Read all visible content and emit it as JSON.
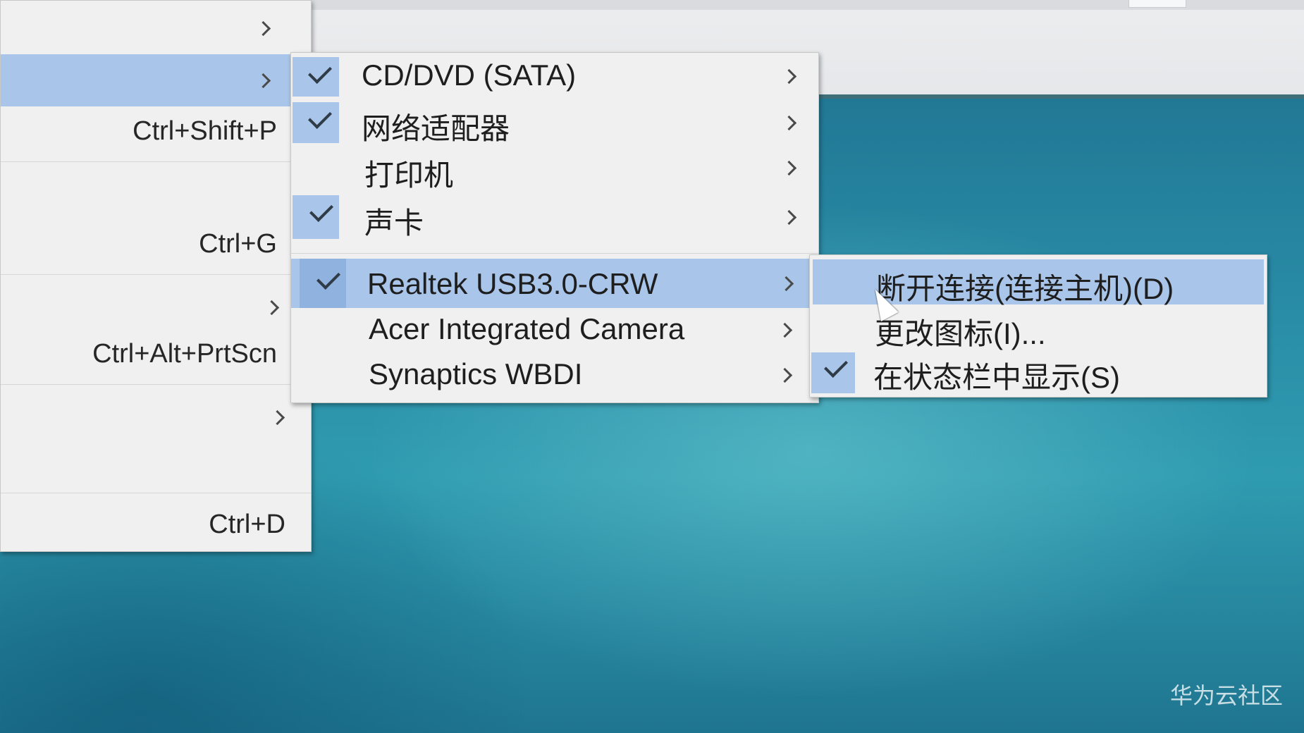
{
  "main_menu": {
    "items": [
      {
        "shortcut": "",
        "has_arrow": true
      },
      {
        "shortcut": "",
        "has_arrow": true,
        "highlighted": true
      },
      {
        "shortcut": "Ctrl+Shift+P",
        "has_arrow": false
      },
      {
        "shortcut": "Ctrl+G",
        "has_arrow": false
      },
      {
        "shortcut": "",
        "has_arrow": true
      },
      {
        "shortcut": "Ctrl+Alt+PrtScn",
        "has_arrow": false
      },
      {
        "shortcut": "",
        "has_arrow": true
      },
      {
        "shortcut": "Ctrl+D",
        "has_arrow": false
      }
    ]
  },
  "devices_menu": {
    "items": [
      {
        "label": "CD/DVD (SATA)",
        "checked": true
      },
      {
        "label": "网络适配器",
        "checked": true
      },
      {
        "label": "打印机",
        "checked": false
      },
      {
        "label": "声卡",
        "checked": true
      },
      {
        "label": "Realtek USB3.0-CRW",
        "checked": true,
        "highlighted": true
      },
      {
        "label": "Acer Integrated Camera",
        "checked": false
      },
      {
        "label": "Synaptics WBDI",
        "checked": false
      }
    ]
  },
  "device_actions_menu": {
    "items": [
      {
        "label": "断开连接(连接主机)(D)",
        "checked": false,
        "highlighted": true
      },
      {
        "label": "更改图标(I)...",
        "checked": false
      },
      {
        "label": "在状态栏中显示(S)",
        "checked": true
      }
    ]
  },
  "watermark": "华为云社区",
  "colors": {
    "highlight": "#a9c6ea",
    "menu_bg": "#f0f0f0",
    "desktop": "#2a8ea8"
  }
}
